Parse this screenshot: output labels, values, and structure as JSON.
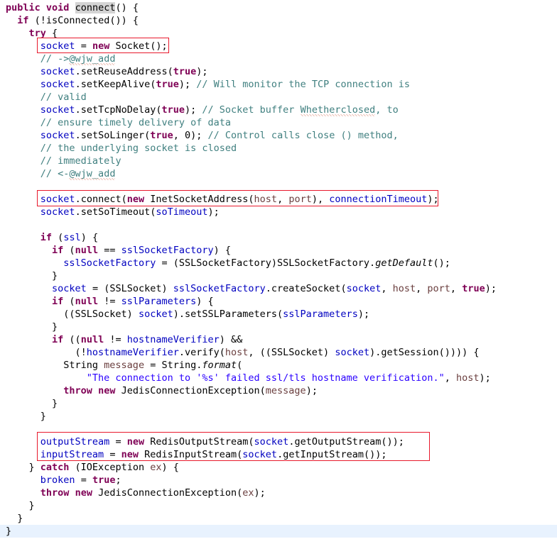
{
  "editor": {
    "type": "java-source-code-viewer",
    "language": "Java",
    "background_color": "#ffffff",
    "current_line_highlight_color": "#e8f2fe",
    "occurrence_highlight_color": "#d4d4d4",
    "annotation_color": "#e8192c",
    "colors": {
      "keyword": "#7f0055",
      "field": "#0000c0",
      "parameter": "#6a3e3e",
      "string": "#2a00ff",
      "comment": "#3f7f7f",
      "default": "#000000"
    }
  },
  "annotations": [
    {
      "name": "socket-new-box",
      "label": "socket = new Socket();"
    },
    {
      "name": "socket-connect-box",
      "label": "socket.connect(new InetSocketAddress(host, port), connectionTimeout);"
    },
    {
      "name": "streams-box",
      "label": "outputStream / inputStream assignment"
    }
  ],
  "code": {
    "lines": [
      {
        "n": 1,
        "text": "public void connect() {"
      },
      {
        "n": 2,
        "text": "  if (!isConnected()) {"
      },
      {
        "n": 3,
        "text": "    try {"
      },
      {
        "n": 4,
        "text": "      socket = new Socket();"
      },
      {
        "n": 5,
        "text": "      // ->@wjw_add"
      },
      {
        "n": 6,
        "text": "      socket.setReuseAddress(true);"
      },
      {
        "n": 7,
        "text": "      socket.setKeepAlive(true); // Will monitor the TCP connection is"
      },
      {
        "n": 8,
        "text": "      // valid"
      },
      {
        "n": 9,
        "text": "      socket.setTcpNoDelay(true); // Socket buffer Whetherclosed, to"
      },
      {
        "n": 10,
        "text": "      // ensure timely delivery of data"
      },
      {
        "n": 11,
        "text": "      socket.setSoLinger(true, 0); // Control calls close () method,"
      },
      {
        "n": 12,
        "text": "      // the underlying socket is closed"
      },
      {
        "n": 13,
        "text": "      // immediately"
      },
      {
        "n": 14,
        "text": "      // <-@wjw_add"
      },
      {
        "n": 15,
        "text": ""
      },
      {
        "n": 16,
        "text": "      socket.connect(new InetSocketAddress(host, port), connectionTimeout);"
      },
      {
        "n": 17,
        "text": "      socket.setSoTimeout(soTimeout);"
      },
      {
        "n": 18,
        "text": ""
      },
      {
        "n": 19,
        "text": "      if (ssl) {"
      },
      {
        "n": 20,
        "text": "        if (null == sslSocketFactory) {"
      },
      {
        "n": 21,
        "text": "          sslSocketFactory = (SSLSocketFactory)SSLSocketFactory.getDefault();"
      },
      {
        "n": 22,
        "text": "        }"
      },
      {
        "n": 23,
        "text": "        socket = (SSLSocket) sslSocketFactory.createSocket(socket, host, port, true);"
      },
      {
        "n": 24,
        "text": "        if (null != sslParameters) {"
      },
      {
        "n": 25,
        "text": "          ((SSLSocket) socket).setSSLParameters(sslParameters);"
      },
      {
        "n": 26,
        "text": "        }"
      },
      {
        "n": 27,
        "text": "        if ((null != hostnameVerifier) &&"
      },
      {
        "n": 28,
        "text": "            (!hostnameVerifier.verify(host, ((SSLSocket) socket).getSession()))) {"
      },
      {
        "n": 29,
        "text": "          String message = String.format("
      },
      {
        "n": 30,
        "text": "              \"The connection to '%s' failed ssl/tls hostname verification.\", host);"
      },
      {
        "n": 31,
        "text": "          throw new JedisConnectionException(message);"
      },
      {
        "n": 32,
        "text": "        }"
      },
      {
        "n": 33,
        "text": "      }"
      },
      {
        "n": 34,
        "text": ""
      },
      {
        "n": 35,
        "text": "      outputStream = new RedisOutputStream(socket.getOutputStream());"
      },
      {
        "n": 36,
        "text": "      inputStream = new RedisInputStream(socket.getInputStream());"
      },
      {
        "n": 37,
        "text": "    } catch (IOException ex) {"
      },
      {
        "n": 38,
        "text": "      broken = true;"
      },
      {
        "n": 39,
        "text": "      throw new JedisConnectionException(ex);"
      },
      {
        "n": 40,
        "text": "    }"
      },
      {
        "n": 41,
        "text": "  }"
      },
      {
        "n": 42,
        "text": "}"
      }
    ],
    "current_line": 42,
    "highlighted_symbol": "connect"
  }
}
